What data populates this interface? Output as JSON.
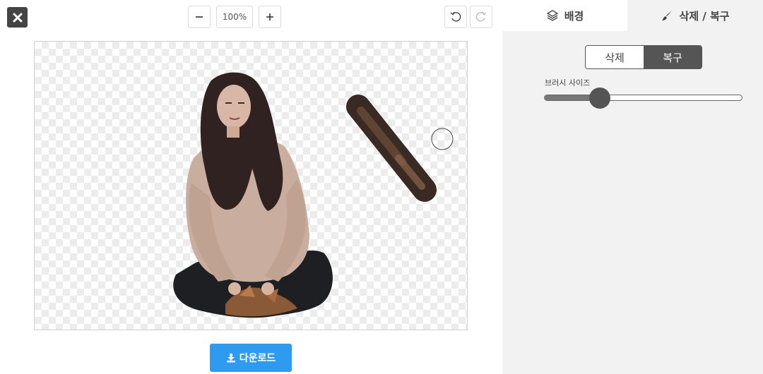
{
  "toolbar": {
    "zoom_level": "100%",
    "close_icon": "close-icon",
    "zoom_out_icon": "minus-icon",
    "zoom_in_icon": "plus-icon",
    "undo_icon": "undo-icon",
    "redo_icon": "redo-icon"
  },
  "download": {
    "label": "다운로드",
    "icon": "download-icon",
    "color": "#2e9bf0"
  },
  "panel": {
    "tabs": [
      {
        "label": "배경",
        "icon": "layers-icon"
      },
      {
        "label": "삭제 / 복구",
        "icon": "brush-icon"
      }
    ],
    "mode": {
      "options": [
        "삭제",
        "복구"
      ],
      "selected": "복구"
    },
    "brush_size_label": "브러시 사이즈",
    "brush_size_fraction": 0.28
  }
}
